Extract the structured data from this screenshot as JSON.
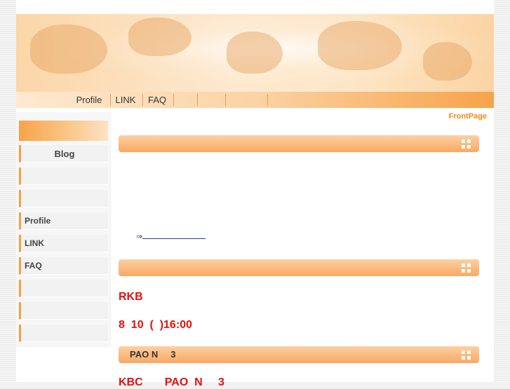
{
  "nav": {
    "items": [
      "Profile",
      "LINK",
      "FAQ"
    ]
  },
  "frontpage_link": "FrontPage",
  "sidebar": {
    "blog": "Blog",
    "profile": "Profile",
    "link": "LINK",
    "faq": "FAQ"
  },
  "content": {
    "arrow": "⇒",
    "rkb": "RKB",
    "datetime": "8  10  (  )16:00",
    "section3_title": "PAO N     3",
    "bottom_partial": "KBC       PAO  N     3"
  },
  "colors": {
    "accent_orange": "#f5a042",
    "headline_red": "#e21010",
    "frontpage_orange": "#f08a1c"
  }
}
